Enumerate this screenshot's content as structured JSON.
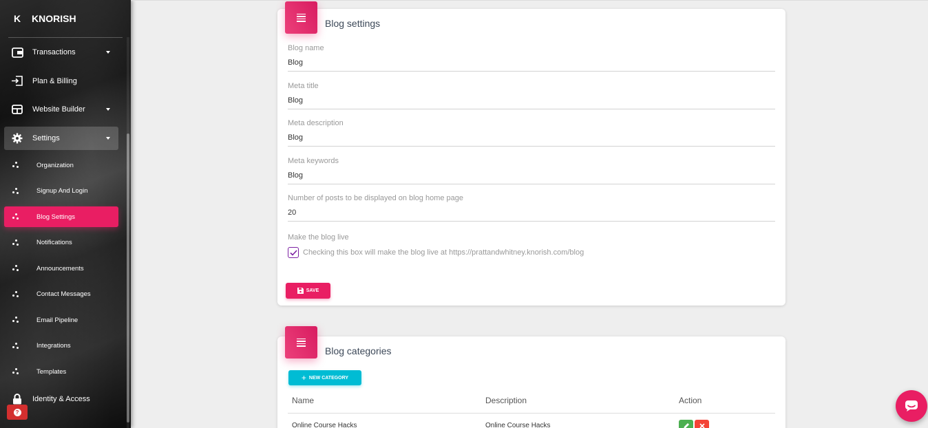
{
  "brand": {
    "mini": "K",
    "name": "KNORISH"
  },
  "nav": {
    "items": [
      {
        "label": "Transactions",
        "icon": "wallet-icon",
        "expandable": true
      },
      {
        "label": "Plan & Billing",
        "icon": "login-icon",
        "expandable": false
      },
      {
        "label": "Website Builder",
        "icon": "layout-icon",
        "expandable": true
      },
      {
        "label": "Settings",
        "icon": "gear-icon",
        "expandable": true,
        "open": true
      }
    ],
    "sub_items": [
      {
        "label": "Organization"
      },
      {
        "label": "Signup And Login"
      },
      {
        "label": "Blog Settings",
        "active": true
      },
      {
        "label": "Notifications"
      },
      {
        "label": "Announcements"
      },
      {
        "label": "Contact Messages"
      },
      {
        "label": "Email Pipeline"
      },
      {
        "label": "Integrations"
      },
      {
        "label": "Templates"
      }
    ],
    "identity": {
      "label": "Identity & Access",
      "icon": "lock-icon"
    },
    "help_icon": "help-icon"
  },
  "blog_settings": {
    "title": "Blog settings",
    "fields": [
      {
        "label": "Blog name",
        "value": "Blog"
      },
      {
        "label": "Meta title",
        "value": "Blog"
      },
      {
        "label": "Meta description",
        "value": "Blog"
      },
      {
        "label": "Meta keywords",
        "value": "Blog"
      },
      {
        "label": "Number of posts to be displayed on blog home page",
        "value": "20"
      }
    ],
    "live_label": "Make the blog live",
    "live_checked": true,
    "live_text": "Checking this box will make the blog live at https://prattandwhitney.knorish.com/blog",
    "save_label": "SAVE"
  },
  "blog_categories": {
    "title": "Blog categories",
    "new_label": "NEW CATEGORY",
    "columns": [
      "Name",
      "Description",
      "Action"
    ],
    "rows": [
      {
        "name": "Online Course Hacks",
        "description": "Online Course Hacks"
      }
    ]
  },
  "colors": {
    "accent": "#e91e63",
    "info": "#00bcd4",
    "success": "#4caf50",
    "danger": "#f44336"
  }
}
